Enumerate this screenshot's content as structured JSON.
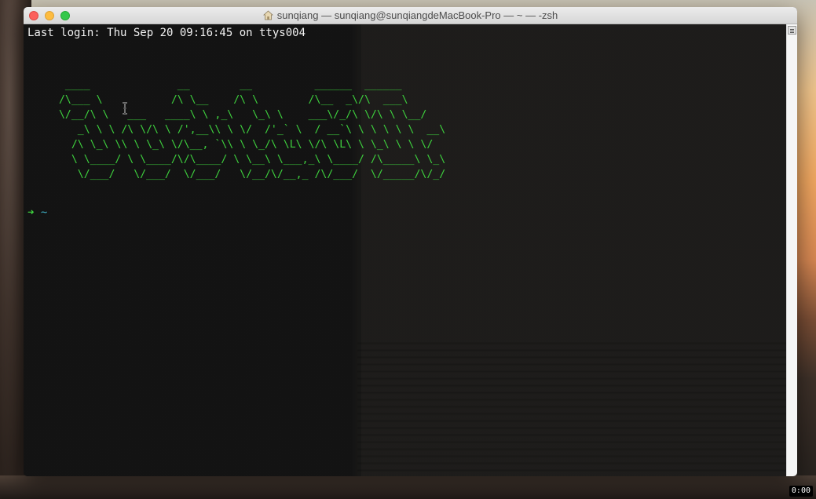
{
  "window": {
    "title": "sunqiang — sunqiang@sunqiangdeMacBook-Pro — ~ — -zsh"
  },
  "terminal": {
    "last_login": "Last login: Thu Sep 20 09:16:45 on ttys004",
    "ascii_art": "  ____              __        __          ______  ______\n /\\___ \\           /\\ \\__    /\\ \\        /\\__  _\\/\\  ___\\\n \\/__/\\ \\   ___   ____\\ \\ ,_\\   \\_\\ \\    ___\\/_/\\ \\/\\ \\ \\__/\n    _\\ \\ \\ /\\ \\/\\ \\ /',__\\\\ \\ \\/  /'_` \\  / __`\\ \\ \\ \\ \\ \\  __\\\n   /\\ \\_\\ \\\\ \\ \\_\\ \\/\\__, `\\\\ \\ \\_/\\ \\L\\ \\/\\ \\L\\ \\ \\_\\ \\ \\ \\/\n   \\ \\____/ \\ \\____/\\/\\____/ \\ \\__\\ \\___,_\\ \\____/ /\\_____\\ \\_\\\n    \\/___/   \\/___/  \\/___/   \\/__/\\/__,_ /\\/___/  \\/_____/\\/_/",
    "prompt_arrow": "➜",
    "prompt_dir": "~"
  },
  "status": {
    "timer": "0:00"
  },
  "colors": {
    "ascii_green": "#3ed13e",
    "prompt_cyan": "#3fb2c7",
    "text": "#f2f2f2"
  },
  "icons": [
    "home-icon",
    "ibeam-cursor-icon",
    "scrollbar-menu-icon"
  ]
}
